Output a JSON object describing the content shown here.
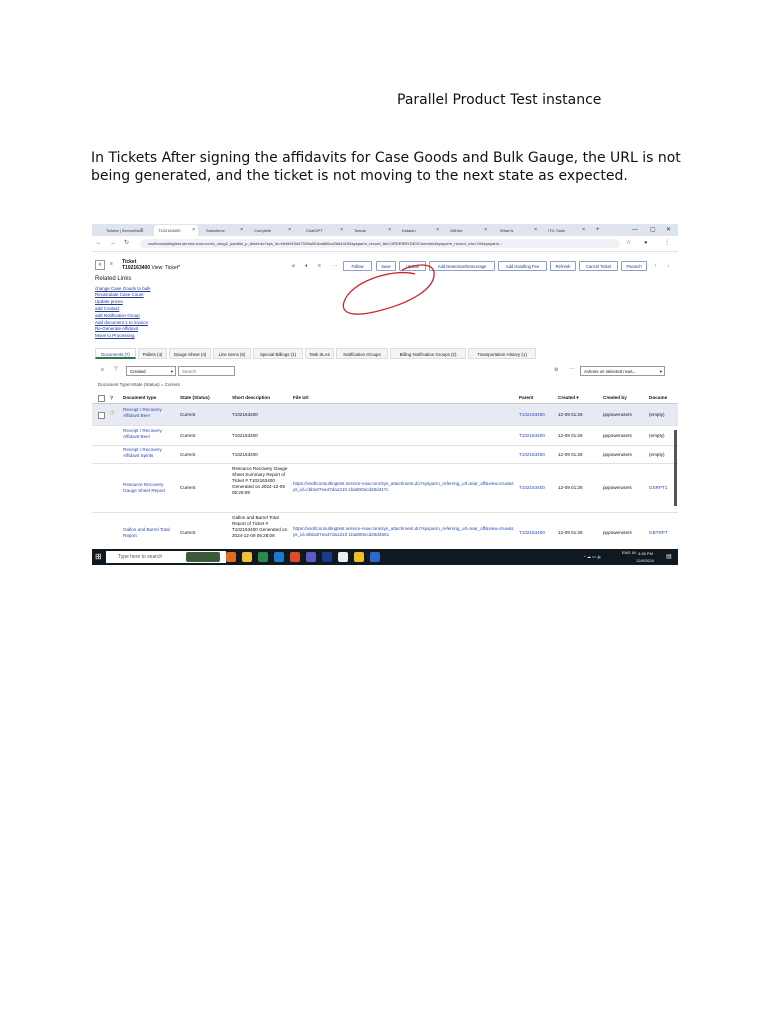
{
  "doc": {
    "title": "Parallel Product Test instance",
    "paragraph": "In Tickets After signing the affidavits for Case Goods and Bulk Gauge, the URL is not being generated, and the ticket is not moving to the next state as expected."
  },
  "browser": {
    "tabs": [
      "Tickets | ServiceNow",
      "T102163400",
      "Salesforce",
      "Complete",
      "ChatGPT",
      "Teams",
      "Katalon",
      "GitHub",
      "What is",
      "ITIL Tools"
    ],
    "window_controls": [
      "—",
      "▢",
      "✕"
    ],
    "url": "vsoftconsultingtest.service-now.com/x_vsng2_parallel_p_ticket.do?sys_id=4fe0fd19d47525a501ba880cd26d4319&sysparm_record_list=ORDERBYDESCnumber&sysparm_record_row=10&sysparm..."
  },
  "ticket": {
    "label": "Ticket",
    "number": "T102163400",
    "view": "View: Ticket*",
    "buttons": [
      "Follow",
      "Save",
      "Update",
      "Add Detention/Demurrage",
      "Add Handling Fee",
      "Refresh",
      "Cancel Ticket",
      "Psearch"
    ]
  },
  "related": {
    "heading": "Related Links",
    "links": [
      "change Case Goods to bulk",
      "Recalculate Case Count",
      "Update prices",
      "add Contact",
      "add Notification Group",
      "Add document 1 to invoice",
      "Re-Generate Affidavit",
      "Move to Processing"
    ]
  },
  "related_tabs": [
    "Documents (7)",
    "Pallets (4)",
    "Gauge Sheet (4)",
    "Line Items (6)",
    "Special Billings (1)",
    "Task SLAs",
    "Notification Groups",
    "Billing Notification Groups (2)",
    "Transportation History (1)"
  ],
  "filter": {
    "field": "Created",
    "search_placeholder": "Search",
    "actions": "Actions on selected rows..."
  },
  "breadcrumb": "Document Type>State (Status) = Current",
  "table": {
    "headers": [
      "Document type",
      "State (Status)",
      "Short description",
      "File Url",
      "Parent",
      "Created ▾",
      "Created by",
      "Docume"
    ],
    "rows": [
      {
        "type": "Receipt / Recovery Affidavit Beer",
        "state": "Current",
        "desc": "T102163400",
        "url": "",
        "parent": "T102163400",
        "created": "12-09 01:28",
        "by": "pppowerusers",
        "doc": "(empty)"
      },
      {
        "type": "Receipt / Recovery Affidavit Beer",
        "state": "Current",
        "desc": "T102163400",
        "url": "",
        "parent": "T102163400",
        "created": "12-09 01:28",
        "by": "pppowerusers",
        "doc": "(empty)"
      },
      {
        "type": "Receipt / Recovery Affidavit Spirits",
        "state": "Current",
        "desc": "T102163400",
        "url": "",
        "parent": "T102163400",
        "created": "12-09 01:28",
        "by": "pppowerusers",
        "doc": "(empty)"
      },
      {
        "type": "Resource Recovery Gauge Sheet Report",
        "state": "Current",
        "desc": "Resource Recovery Gauge Sheet Summary Report of Ticket # T102163400 Generated on 2024-12-09 06:28:09",
        "url": "https://vsoftconsultingtest.service-now.com/sys_attachment.do?sysparm_referring_url=tear_off&view=true&sys_id=cbbe07ea47da1210 1ba800ecd26d417c",
        "parent": "T102163400",
        "created": "12-09 01:28",
        "by": "pppowerusers",
        "doc": "GSRPT1"
      },
      {
        "type": "Gallon and Barrel Total Report",
        "state": "Current",
        "desc": "Gallon and Barrel Total Report of Ticket # T102163400 Generated on 2024-12-09 06:28:08",
        "url": "https://vsoftconsultingtest.service-now.com/sys_attachment.do?sysparm_referring_url=tear_off&view=true&sys_id=8bba07ea47da1210 1ba800ecd26d4561",
        "parent": "T102163400",
        "created": "12-09 01:28",
        "by": "pppowerusers",
        "doc": "GBTRPT"
      }
    ]
  },
  "taskbar": {
    "search_placeholder": "Type here to search",
    "lang": "ENG IN",
    "time": "4:48 PM",
    "date": "12/9/2024"
  },
  "colors": {
    "link": "#2947b8",
    "active_tab_underline": "#2a7a3b",
    "scribble": "#d0222b",
    "taskbar": "#101820"
  }
}
